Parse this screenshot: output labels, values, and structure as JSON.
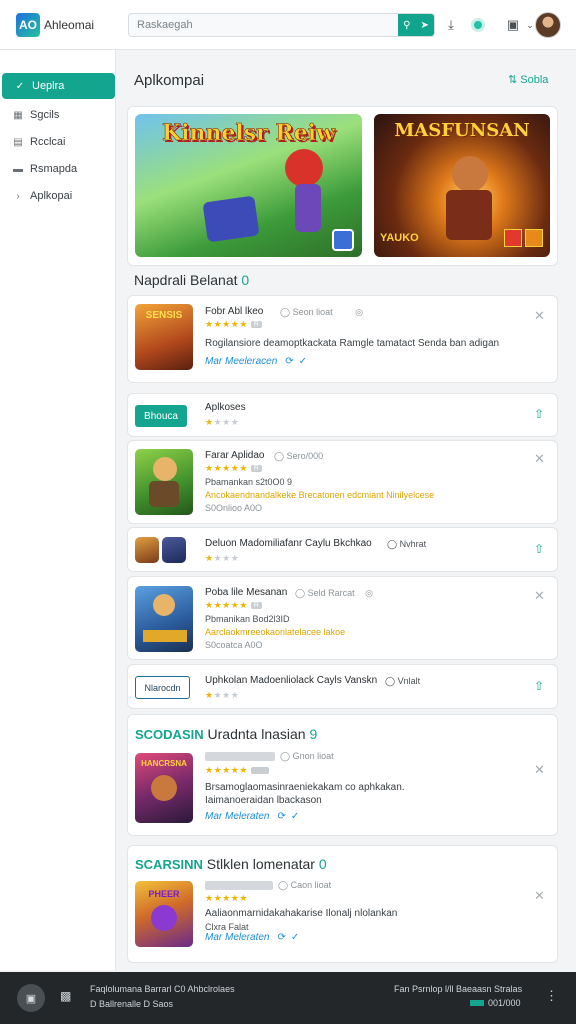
{
  "header": {
    "logo_text": "AO",
    "app_title": "Ahleomai",
    "search_placeholder": "Raskaegah",
    "search_btn_icons": [
      "search-icon",
      "send-icon"
    ],
    "icons": [
      "download-icon",
      "chat-icon",
      "camera-icon",
      "chevron-down-icon"
    ]
  },
  "sidebar": {
    "items": [
      {
        "label": "Ueplra",
        "icon": "home-icon"
      },
      {
        "label": "Sgcils",
        "icon": "grid-icon"
      },
      {
        "label": "Rcclcai",
        "icon": "list-icon"
      },
      {
        "label": "Rsmapda",
        "icon": "card-icon"
      },
      {
        "label": "Aplkopai",
        "icon": "chevron-right-icon"
      }
    ]
  },
  "main": {
    "title": "Aplkompai",
    "action": "Sobla",
    "banners": [
      {
        "title": "Kinnelsr Reiw"
      },
      {
        "title": "MASFUNSAN",
        "sub": "YAUKO"
      }
    ],
    "section1": {
      "title": "Napdrali Belanat",
      "count": "0",
      "item": {
        "thumb_text": "SENSIS",
        "title": "Fobr Abl lkeo",
        "meta": "Seon lioat",
        "badge": "R",
        "desc": "Rogilansiore deamoptkackata Ramgle tamatact Senda ban adigan",
        "link": "Mar Meeleracen"
      }
    },
    "aplkoses": {
      "button": "Bhouca",
      "title": "Aplkoses"
    },
    "list": [
      {
        "title": "Farar Aplidao",
        "meta": "Sero/000",
        "badge": "R",
        "line1": "Pbamankan     s2t0O0 9",
        "line2": "Ancokaendnandalkeke Brecatonen edcmiant Ninilyelcese",
        "line3": "S0Onlioo A0O"
      },
      {
        "title": "Deluon Madomiliafanr Caylu Bkchkao",
        "extra": "Nvhrat",
        "kind": "compact"
      },
      {
        "title": "Poba lile Mesanan",
        "meta": "Seld Rarcat",
        "badge": "R",
        "line1": "Pbmanikan     Bod2l3ID",
        "line2": "Aarclaokmreeokaonlatelacee lakoe",
        "line3": "S0coatca A0O"
      },
      {
        "button": "Nlarocdn",
        "title": "Uphkolan Madoenliolack Cayls Vanskn",
        "extra": "Vnlalt",
        "kind": "compact-btn"
      }
    ],
    "section2": {
      "prefix": "SCODASIN",
      "title": "Uradnta lnasian",
      "count": "9",
      "item": {
        "thumb_text": "HANCRSNA",
        "meta": "Gnon lioat",
        "line1": "Brsamoglaomasinraeniekakam co aphkakan.",
        "line2": "Iaimanoeraidan lbackason",
        "link": "Mar Meleraten"
      }
    },
    "section3": {
      "prefix": "SCARSINN",
      "title": "Stlklen lomenatar",
      "count": "0",
      "item": {
        "thumb_text": "PHEER",
        "meta": "Caon lioat",
        "line1": "Aaliaonmarnidakahakarise Ilonalj nlolankan",
        "line2": "Clxra Falat",
        "link": "Mar Meleraten"
      }
    }
  },
  "statusbar": {
    "line1": "Faqlolumana Barrarl   C0   Ahbclrolaes",
    "line2": "D Ballrenalle    D Saos",
    "right1": "Fan Psrnlop l/ll Baeaasn Stralas",
    "right2": "001/000"
  }
}
